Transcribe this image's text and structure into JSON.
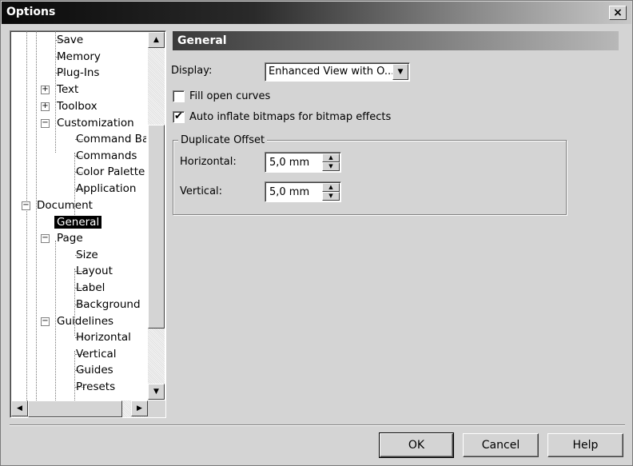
{
  "window": {
    "title": "Options",
    "close_glyph": "×"
  },
  "tree": {
    "items": [
      {
        "label": "Save"
      },
      {
        "label": "Memory"
      },
      {
        "label": "Plug-Ins"
      },
      {
        "label": "Text",
        "expander": "+"
      },
      {
        "label": "Toolbox",
        "expander": "+"
      },
      {
        "label": "Customization",
        "expander": "−"
      },
      {
        "label": "Command Bars"
      },
      {
        "label": "Commands"
      },
      {
        "label": "Color Palette"
      },
      {
        "label": "Application"
      },
      {
        "label": "Document",
        "expander": "−"
      },
      {
        "label": "General",
        "selected": true
      },
      {
        "label": "Page",
        "expander": "−"
      },
      {
        "label": "Size"
      },
      {
        "label": "Layout"
      },
      {
        "label": "Label"
      },
      {
        "label": "Background"
      },
      {
        "label": "Guidelines",
        "expander": "−"
      },
      {
        "label": "Horizontal"
      },
      {
        "label": "Vertical"
      },
      {
        "label": "Guides"
      },
      {
        "label": "Presets"
      }
    ]
  },
  "panel": {
    "title": "General",
    "display_label": "Display:",
    "display_value": "Enhanced View with O...",
    "fill_open_curves": {
      "label": "Fill open curves",
      "checked": false
    },
    "auto_inflate": {
      "label": "Auto inflate bitmaps for bitmap effects",
      "checked": true,
      "mark": "✔"
    },
    "duplicate_offset": {
      "title": "Duplicate Offset",
      "horizontal_label": "Horizontal:",
      "horizontal_value": "5,0 mm",
      "vertical_label": "Vertical:",
      "vertical_value": "5,0 mm"
    }
  },
  "buttons": {
    "ok": "OK",
    "cancel": "Cancel",
    "help": "Help"
  },
  "glyphs": {
    "up": "▲",
    "down": "▼",
    "left": "◀",
    "right": "▶"
  },
  "icons": [
    "close-icon",
    "scroll-up-icon",
    "scroll-down-icon",
    "scroll-left-icon",
    "scroll-right-icon",
    "checkmark-icon",
    "dropdown-arrow-icon"
  ]
}
